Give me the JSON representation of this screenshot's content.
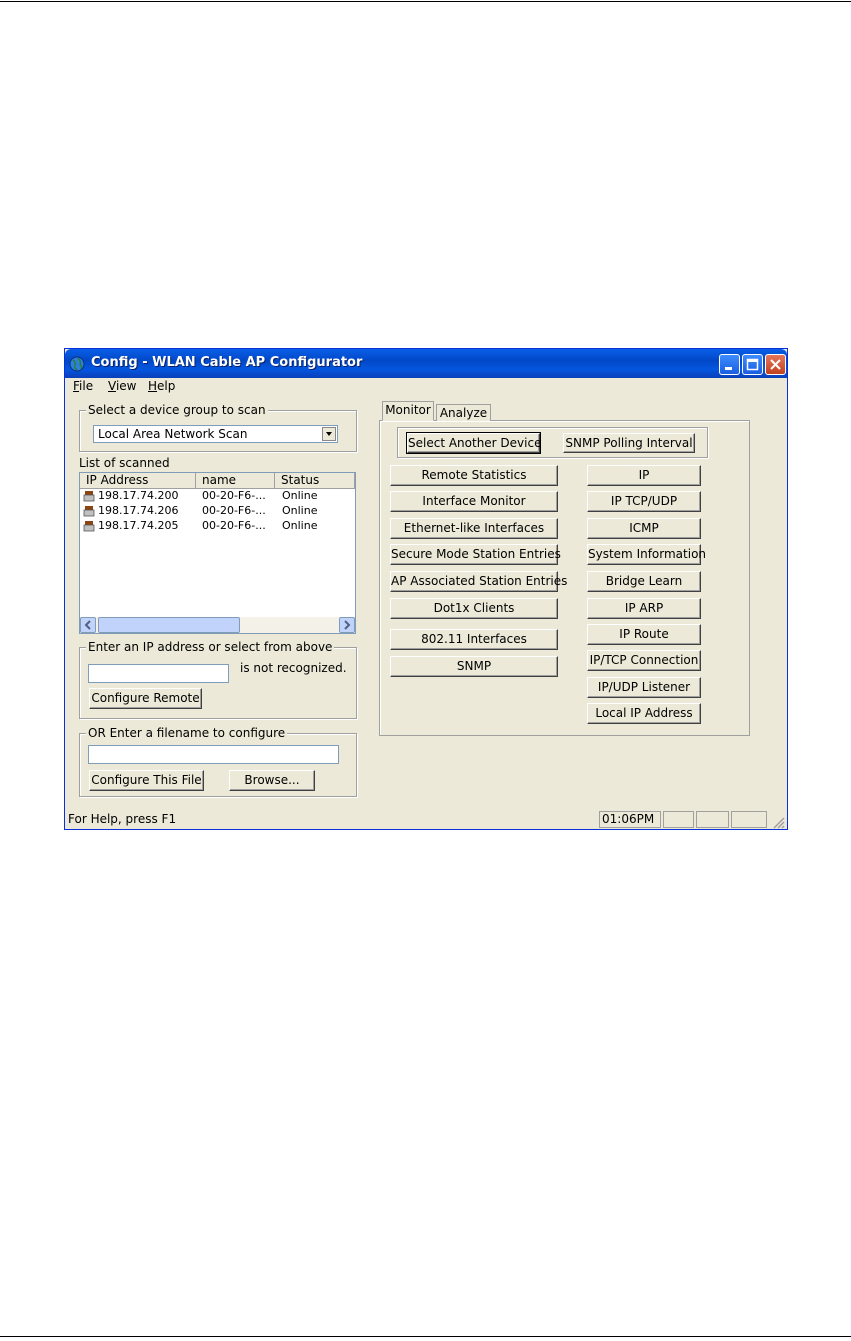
{
  "window": {
    "title": "Config - WLAN Cable AP Configurator"
  },
  "menu": [
    {
      "label": "File",
      "key": "F",
      "rest": "ile"
    },
    {
      "label": "View",
      "key": "V",
      "rest": "iew"
    },
    {
      "label": "Help",
      "key": "H",
      "rest": "elp"
    }
  ],
  "scan_group": {
    "label": "Select a device group to scan",
    "selected": "Local Area Network Scan"
  },
  "list": {
    "label": "List of scanned",
    "columns": [
      "IP Address",
      "name",
      "Status"
    ],
    "rows": [
      {
        "ip": "198.17.74.200",
        "name": "00-20-F6-...",
        "status": "Online"
      },
      {
        "ip": "198.17.74.206",
        "name": "00-20-F6-...",
        "status": "Online"
      },
      {
        "ip": "198.17.74.205",
        "name": "00-20-F6-...",
        "status": "Online"
      }
    ]
  },
  "ip_group": {
    "label": "Enter an IP address or select from above",
    "ip_value": "",
    "not_recognized": "is not recognized.",
    "configure_remote": "Configure Remote"
  },
  "file_group": {
    "label": "OR Enter a filename to configure",
    "file_value": "",
    "configure_file": "Configure This File",
    "browse": "Browse..."
  },
  "tabs": [
    "Monitor",
    "Analyze"
  ],
  "top_buttons": {
    "select_device": "Select Another Device",
    "snmp_polling": "SNMP Polling Interval"
  },
  "left_buttons": [
    "Remote Statistics",
    "Interface Monitor",
    "Ethernet-like Interfaces",
    "Secure Mode Station Entries",
    "AP Associated Station Entries",
    "Dot1x Clients",
    "802.11 Interfaces",
    "SNMP"
  ],
  "right_buttons": [
    "IP",
    "IP TCP/UDP",
    "ICMP",
    "System Information",
    "Bridge Learn",
    "IP ARP",
    "IP Route",
    "IP/TCP Connection",
    "IP/UDP Listener",
    "Local IP Address"
  ],
  "status": {
    "help": "For Help, press F1",
    "time": "01:06PM"
  },
  "colors": {
    "titlebar": "#0148c7",
    "face": "#ece9d8"
  }
}
